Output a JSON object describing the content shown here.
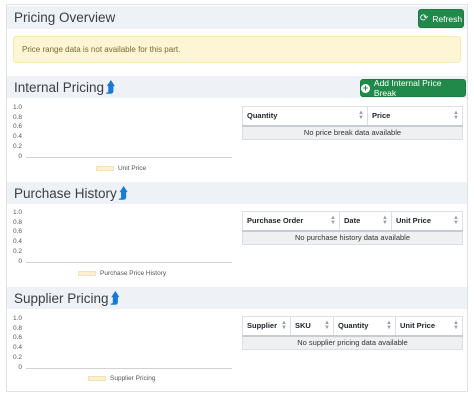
{
  "header": {
    "title": "Pricing Overview",
    "refresh_label": "Refresh",
    "refresh_icon": "refresh-icon"
  },
  "alert": {
    "message": "Price range data is not available for this part."
  },
  "internal_pricing": {
    "title": "Internal Pricing",
    "add_button_label": "Add Internal Price Break",
    "chart_legend": "Unit Price",
    "columns": [
      "Quantity",
      "Price"
    ],
    "empty_message": "No price break data available"
  },
  "purchase_history": {
    "title": "Purchase History",
    "chart_legend": "Purchase Price History",
    "columns": [
      "Purchase Order",
      "Date",
      "Unit Price"
    ],
    "empty_message": "No purchase history data available"
  },
  "supplier_pricing": {
    "title": "Supplier Pricing",
    "chart_legend": "Supplier Pricing",
    "columns": [
      "Supplier",
      "SKU",
      "Quantity",
      "Unit Price"
    ],
    "empty_message": "No supplier pricing data available"
  },
  "chart_ticks": [
    "1.0",
    "0.8",
    "0.6",
    "0.4",
    "0.2",
    "0"
  ],
  "colors": {
    "accent_green": "#218a4a",
    "arrow_blue": "#1779d9",
    "alert_bg": "#fdf5d3",
    "legend_swatch": "#fcf0cf"
  }
}
